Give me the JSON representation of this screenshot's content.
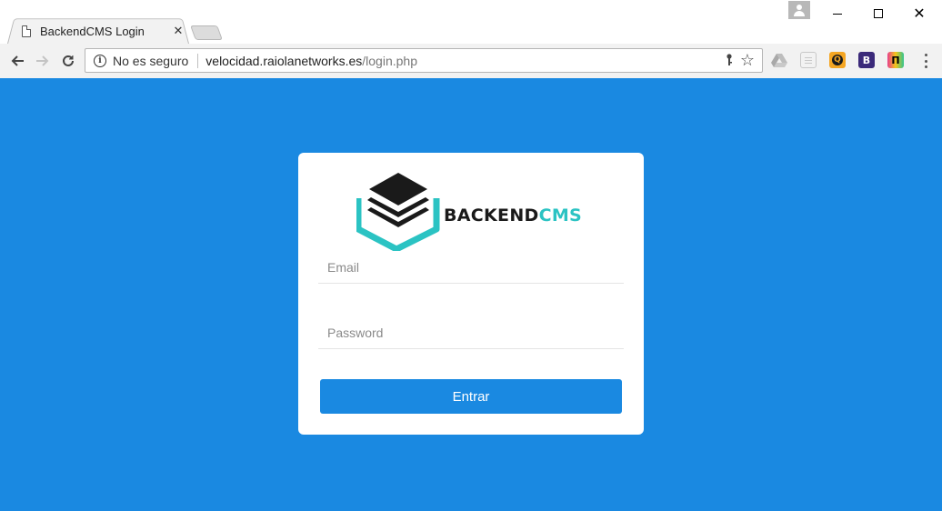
{
  "browser": {
    "tab_title": "BackendCMS Login",
    "tab_close": "✕",
    "window_min": "minimize",
    "window_max": "maximize",
    "window_close": "✕",
    "security_text": "No es seguro",
    "url_host": "velocidad.raiolanetworks.es",
    "url_path": "/login.php",
    "extensions": [
      {
        "name": "google-drive-icon"
      },
      {
        "name": "document-icon"
      },
      {
        "name": "orange-extension-icon",
        "label": "Q"
      },
      {
        "name": "b-extension-icon",
        "label": "B"
      },
      {
        "name": "p-extension-icon",
        "label": "П"
      }
    ]
  },
  "login": {
    "logo_text_dark": "BACKEND",
    "logo_text_accent": "CMS",
    "email_placeholder": "Email",
    "password_placeholder": "Password",
    "submit_label": "Entrar"
  },
  "colors": {
    "background": "#1a89e1",
    "button": "#1a89e1",
    "logo_accent": "#2bc3c3",
    "logo_dark": "#1a1a1a"
  }
}
